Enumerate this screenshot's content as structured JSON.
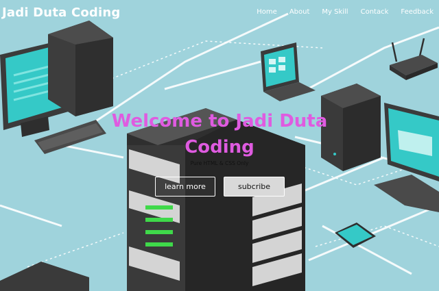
{
  "brand": "Jadi Duta Coding",
  "nav": [
    "Home",
    "About",
    "My Skill",
    "Contack",
    "Feedback"
  ],
  "hero": {
    "title": "Welcome to Jadi Duta Coding",
    "tagline": "Pure HTML & CSS Only",
    "learn_more": "learn more",
    "subscribe": "subcribe"
  },
  "colors": {
    "background": "#9fd3dc",
    "title": "#df5be0",
    "screen": "#35c9c7"
  }
}
